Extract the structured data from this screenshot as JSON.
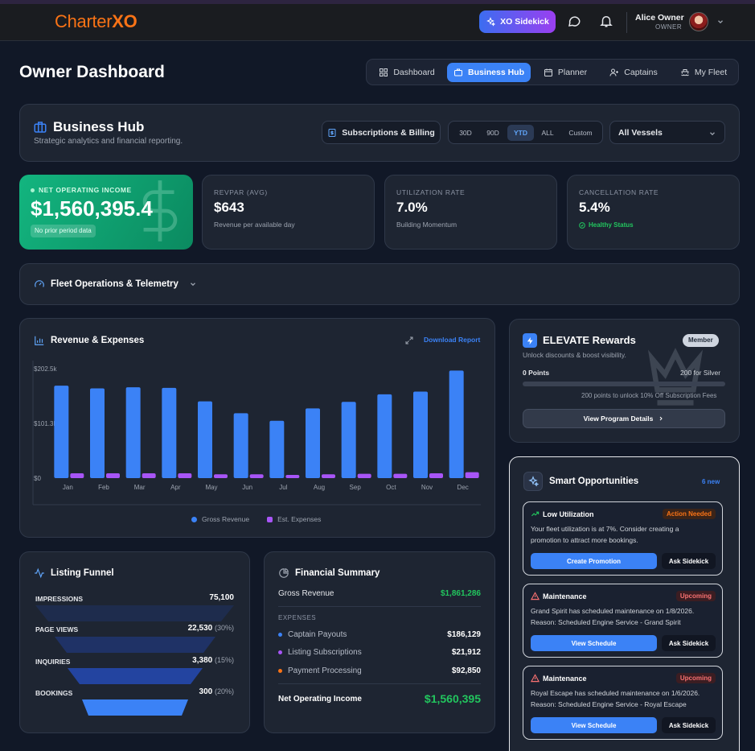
{
  "brand": {
    "name_part1": "Charter",
    "name_part2": "XO"
  },
  "topbar": {
    "sidekick_label": "XO Sidekick",
    "user_name": "Alice Owner",
    "user_role": "OWNER"
  },
  "page": {
    "title": "Owner Dashboard"
  },
  "nav": [
    {
      "label": "Dashboard",
      "icon": "grid-icon",
      "active": false
    },
    {
      "label": "Business Hub",
      "icon": "briefcase-icon",
      "active": true
    },
    {
      "label": "Planner",
      "icon": "calendar-icon",
      "active": false
    },
    {
      "label": "Captains",
      "icon": "user-plus-icon",
      "active": false
    },
    {
      "label": "My Fleet",
      "icon": "ship-icon",
      "active": false
    }
  ],
  "hub": {
    "title": "Business Hub",
    "subtitle": "Strategic analytics and financial reporting.",
    "subscriptions_label": "Subscriptions & Billing",
    "ranges": [
      "30D",
      "90D",
      "YTD",
      "ALL",
      "Custom"
    ],
    "active_range": "YTD",
    "vessel_filter": "All Vessels"
  },
  "kpis": {
    "noi": {
      "label": "NET OPERATING INCOME",
      "value": "$1,560,395.4",
      "note": "No prior period data"
    },
    "revpar": {
      "label": "REVPAR (AVG)",
      "value": "$643",
      "note": "Revenue per available day"
    },
    "utilization": {
      "label": "UTILIZATION RATE",
      "value": "7.0%",
      "note": "Building Momentum"
    },
    "cancellation": {
      "label": "CANCELLATION RATE",
      "value": "5.4%",
      "note": "Healthy Status"
    }
  },
  "fleet": {
    "title": "Fleet Operations & Telemetry"
  },
  "revenue": {
    "title": "Revenue & Expenses",
    "download_label": "Download Report"
  },
  "chart_data": {
    "type": "bar",
    "categories": [
      "Jan",
      "Feb",
      "Mar",
      "Apr",
      "May",
      "Jun",
      "Jul",
      "Aug",
      "Sep",
      "Oct",
      "Nov",
      "Dec"
    ],
    "series": [
      {
        "name": "Gross Revenue",
        "color": "#3b82f6",
        "values": [
          171,
          166,
          168,
          167,
          142,
          120,
          106,
          129,
          141,
          155,
          160,
          199
        ]
      },
      {
        "name": "Est. Expenses",
        "color": "#a855f7",
        "values": [
          9,
          9,
          9,
          9,
          7,
          7,
          6,
          7,
          8,
          8,
          9,
          11
        ]
      }
    ],
    "y_ticks": [
      "$0",
      "$101.3k",
      "$202.5k"
    ],
    "ylim": [
      0,
      202.5
    ],
    "grid": false,
    "legend": "bottom"
  },
  "rewards": {
    "title": "ELEVATE Rewards",
    "badge": "Member",
    "subtitle": "Unlock discounts & boost visibility.",
    "points": "0 Points",
    "target": "200 for Silver",
    "progress_fraction": 0,
    "unlock_note": "200 points to unlock 10% Off Subscription Fees",
    "button": "View Program Details"
  },
  "smart": {
    "title": "Smart Opportunities",
    "new_count": "6 new",
    "items": [
      {
        "title": "Low Utilization",
        "badge": "Action Needed",
        "badge_color": "#f97316",
        "text_lines": [
          "Your fleet utilization is at 7%. Consider creating a",
          "promotion to attract more bookings."
        ],
        "primary": "Create Promotion",
        "secondary": "Ask Sidekick"
      },
      {
        "title": "Maintenance",
        "badge": "Upcoming",
        "badge_color": "#f87171",
        "text_lines": [
          "Grand Spirit has scheduled maintenance on 1/8/2026.",
          "Reason: Scheduled Engine Service - Grand Spirit"
        ],
        "primary": "View Schedule",
        "secondary": "Ask Sidekick"
      },
      {
        "title": "Maintenance",
        "badge": "Upcoming",
        "badge_color": "#f87171",
        "text_lines": [
          "Royal Escape has scheduled maintenance on 1/6/2026.",
          "Reason: Scheduled Engine Service - Royal Escape"
        ],
        "primary": "View Schedule",
        "secondary": "Ask Sidekick"
      }
    ]
  },
  "funnel": {
    "title": "Listing Funnel",
    "stages": [
      {
        "label": "IMPRESSIONS",
        "value": "75,100",
        "pct": ""
      },
      {
        "label": "PAGE VIEWS",
        "value": "22,530",
        "pct": "(30%)"
      },
      {
        "label": "INQUIRIES",
        "value": "3,380",
        "pct": "(15%)"
      },
      {
        "label": "BOOKINGS",
        "value": "300",
        "pct": "(20%)"
      }
    ]
  },
  "financial": {
    "title": "Financial Summary",
    "gross_label": "Gross Revenue",
    "gross_value": "$1,861,286",
    "expenses_header": "EXPENSES",
    "expenses": [
      {
        "label": "Captain Payouts",
        "value": "$186,129",
        "color": "#3b82f6"
      },
      {
        "label": "Listing Subscriptions",
        "value": "$21,912",
        "color": "#a855f7"
      },
      {
        "label": "Payment Processing",
        "value": "$92,850",
        "color": "#f97316"
      }
    ],
    "noi_label": "Net Operating Income",
    "noi_value": "$1,560,395"
  }
}
